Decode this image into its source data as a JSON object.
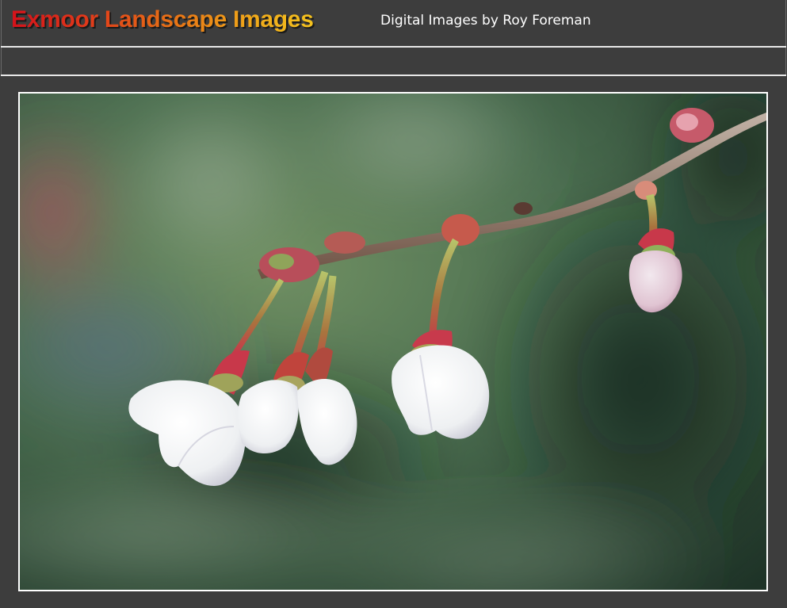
{
  "header": {
    "site_title": "Exmoor Landscape Images",
    "subtitle": "Digital Images by Roy Foreman"
  },
  "photo": {
    "subject": "blossom-buds-on-branch"
  },
  "colors": {
    "background": "#3d3d3d",
    "title_gradient_start": "#d4121b",
    "title_gradient_end": "#f4c21e",
    "frame_border": "#ffffff"
  }
}
